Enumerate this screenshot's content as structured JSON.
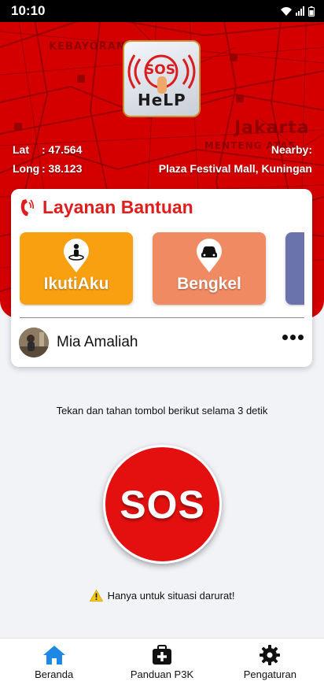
{
  "status_bar": {
    "time": "10:10"
  },
  "map": {
    "labels": [
      "KEBAYORAN",
      "Jakarta",
      "MENTENG ATAS"
    ]
  },
  "app": {
    "logo_top": "SOS",
    "logo_bottom": "HeLP"
  },
  "location": {
    "lat_label": "Lat",
    "lat_value": ": 47.564",
    "long_label": "Long",
    "long_value": ": 38.123",
    "nearby_label": "Nearby:",
    "nearby_value": "Plaza Festival Mall, Kuningan"
  },
  "services": {
    "title": "Layanan Bantuan",
    "items": [
      {
        "label": "IkutiAku",
        "color": "#f9a011",
        "icon": "person-pin-icon"
      },
      {
        "label": "Bengkel",
        "color": "#f08a62",
        "icon": "car-pin-icon"
      },
      {
        "label": "",
        "color": "#6b73ad",
        "icon": ""
      }
    ]
  },
  "contact": {
    "name": "Mia Amaliah"
  },
  "sos": {
    "instruction": "Tekan dan tahan tombol berikut selama 3 detik",
    "label": "SOS",
    "warning": "Hanya untuk situasi darurat!"
  },
  "nav": {
    "items": [
      {
        "label": "Beranda",
        "icon": "home-icon",
        "color": "#1e88e5"
      },
      {
        "label": "Panduan P3K",
        "icon": "first-aid-kit-icon",
        "color": "#111111"
      },
      {
        "label": "Pengaturan",
        "icon": "gear-icon",
        "color": "#111111"
      }
    ]
  },
  "colors": {
    "map_red": "#d40000",
    "accent_red": "#e01d1d",
    "sos_red": "#e41010",
    "nav_active": "#1e88e5"
  }
}
